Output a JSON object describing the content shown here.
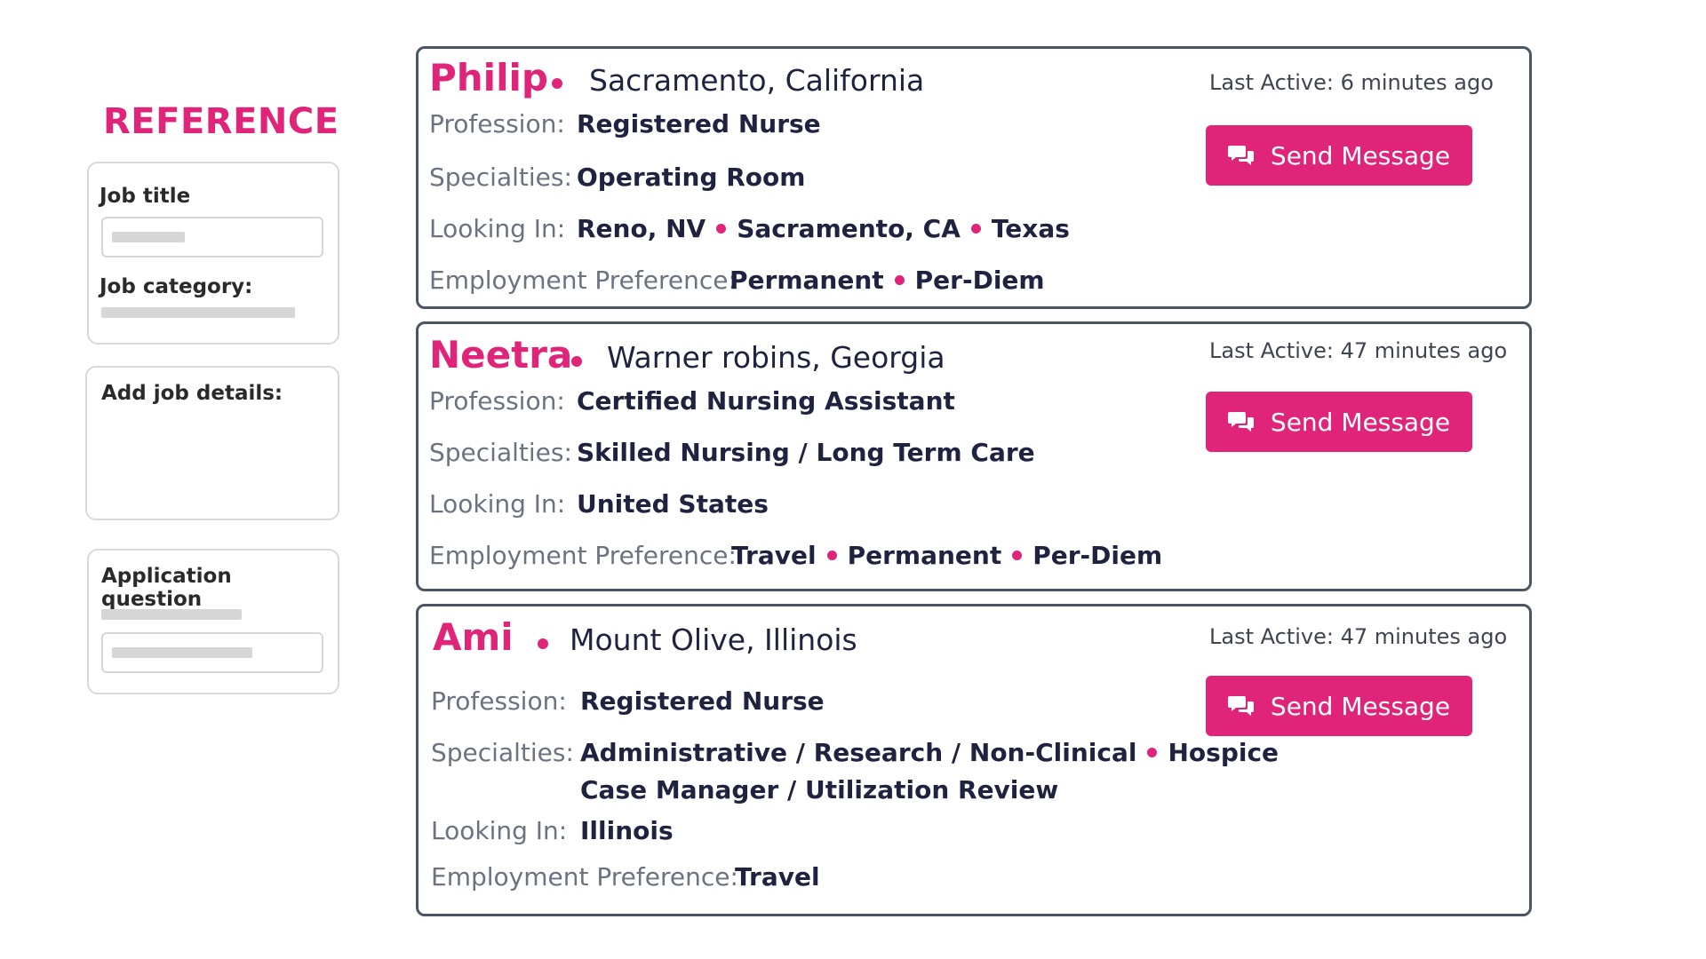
{
  "reference": {
    "title": "REFERENCE",
    "job_title_label": "Job title",
    "job_category_label": "Job category:",
    "add_job_details_label": "Add job details:",
    "application_question_label": "Application question"
  },
  "profiles": [
    {
      "name": "Philip",
      "location": "Sacramento, California",
      "last_active": "Last Active: 6 minutes ago",
      "profession_label": "Profession:",
      "profession": "Registered Nurse",
      "specialties_label": "Specialties:",
      "specialties": [
        "Operating Room"
      ],
      "looking_in_label": "Looking In:",
      "looking_in": [
        "Reno, NV",
        "Sacramento, CA",
        "Texas"
      ],
      "employment_label": "Employment Preference:",
      "employment": [
        "Permanent",
        "Per-Diem"
      ],
      "button_label": "Send Message"
    },
    {
      "name": "Neetra",
      "location": "Warner robins, Georgia",
      "last_active": "Last Active: 47 minutes ago",
      "profession_label": "Profession:",
      "profession": "Certified Nursing Assistant",
      "specialties_label": "Specialties:",
      "specialties": [
        "Skilled Nursing / Long Term Care"
      ],
      "looking_in_label": "Looking In:",
      "looking_in": [
        "United States"
      ],
      "employment_label": "Employment Preference:",
      "employment": [
        "Travel",
        "Permanent",
        "Per-Diem"
      ],
      "button_label": "Send Message"
    },
    {
      "name": "Ami",
      "location": "Mount Olive, Illinois",
      "last_active": "Last Active: 47 minutes ago",
      "profession_label": "Profession:",
      "profession": "Registered Nurse",
      "specialties_label": "Specialties:",
      "specialties": [
        "Administrative / Research / Non-Clinical",
        "Hospice"
      ],
      "specialties_line2": "Case Manager / Utilization Review",
      "looking_in_label": "Looking In:",
      "looking_in": [
        "Illinois"
      ],
      "employment_label": "Employment Preference:",
      "employment": [
        "Travel"
      ],
      "button_label": "Send Message"
    }
  ],
  "colors": {
    "accent": "#e0247a",
    "text": "#1f2340",
    "label": "#6b7280",
    "border": "#4b5563"
  },
  "icons": {
    "send_button": "chat-bubbles-icon"
  }
}
